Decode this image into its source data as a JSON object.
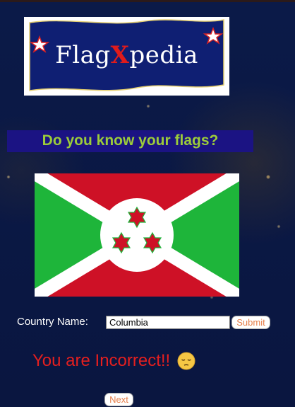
{
  "logo": {
    "part1": "Flag",
    "part2": "X",
    "part3": "pedia"
  },
  "title": "Do you know your flags?",
  "flag": {
    "colors": {
      "red": "#ce1126",
      "green": "#1eb53a",
      "white": "#ffffff"
    }
  },
  "form": {
    "country_label": "Country Name:",
    "country_value": "Columbia",
    "submit_label": "Submit"
  },
  "result": {
    "message": "You are Incorrect!!",
    "emoji": "pensive-face-icon"
  },
  "next_label": "Next",
  "colors": {
    "background": "#0c1a4a",
    "title_bar": "#1b1383",
    "title_text": "#9ccc3a",
    "result_text": "#e41f1f",
    "button_text": "#e67f4a"
  }
}
